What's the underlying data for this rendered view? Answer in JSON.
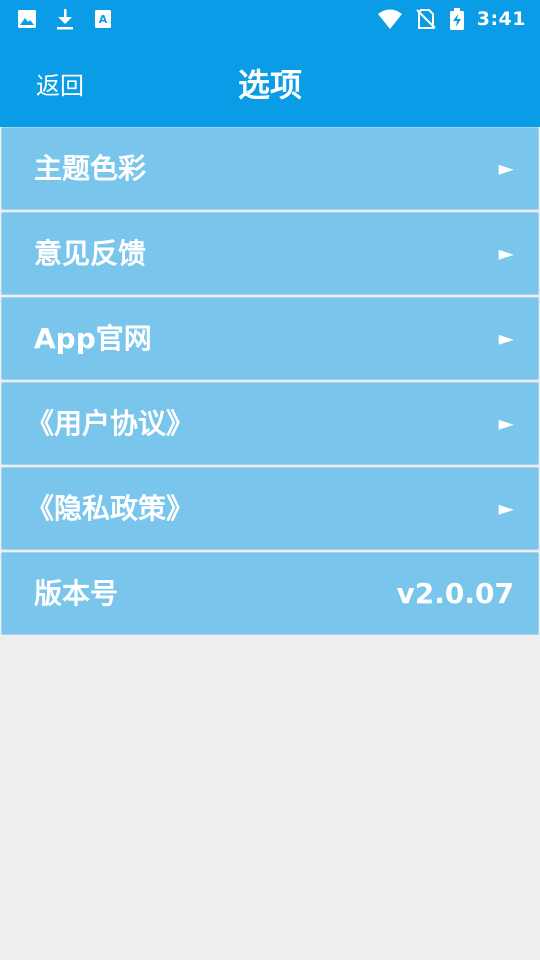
{
  "status_bar": {
    "time": "3:41",
    "left_icons": [
      "image-icon",
      "download-icon",
      "font-app-icon"
    ],
    "right_icons": [
      "wifi-icon",
      "no-sim-icon",
      "battery-charging-icon"
    ]
  },
  "header": {
    "back_label": "返回",
    "title": "选项",
    "color": "#0a9ce6"
  },
  "menu": {
    "row_color": "#79c5ec",
    "items": [
      {
        "label": "主题色彩",
        "arrow": "►"
      },
      {
        "label": "意见反馈",
        "arrow": "►"
      },
      {
        "label": "App官网",
        "arrow": "►"
      },
      {
        "label": "《用户协议》",
        "arrow": "►"
      },
      {
        "label": "《隐私政策》",
        "arrow": "►"
      }
    ],
    "version": {
      "label": "版本号",
      "value": "v2.0.07"
    }
  }
}
